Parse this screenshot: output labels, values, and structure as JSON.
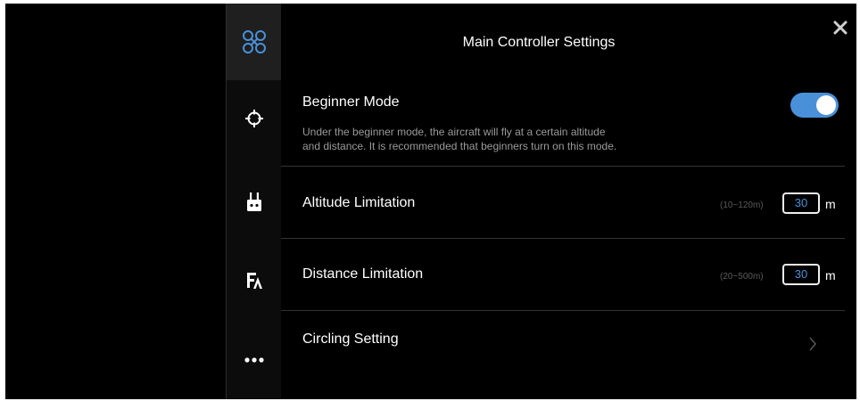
{
  "header": {
    "title": "Main Controller Settings"
  },
  "sidebar": {
    "items": [
      {
        "icon": "drone-icon",
        "active": true
      },
      {
        "icon": "crosshair-icon",
        "active": false
      },
      {
        "icon": "remote-controller-icon",
        "active": false
      },
      {
        "icon": "display-settings-icon",
        "active": false
      },
      {
        "icon": "more-icon",
        "active": false
      }
    ]
  },
  "settings": {
    "beginner_mode": {
      "label": "Beginner Mode",
      "enabled": true,
      "description_line1": "Under the beginner mode, the aircraft will fly at a certain altitude",
      "description_line2": "and distance. It is recommended that beginners turn on this mode."
    },
    "altitude_limitation": {
      "label": "Altitude Limitation",
      "range": "(10~120m)",
      "value": "30",
      "unit": "m"
    },
    "distance_limitation": {
      "label": "Distance Limitation",
      "range": "(20~500m)",
      "value": "30",
      "unit": "m"
    },
    "circling_setting": {
      "label": "Circling Setting"
    }
  },
  "colors": {
    "accent": "#4a90d9",
    "background": "#000000",
    "sidebar": "#0c0c0c",
    "sidebar_active": "#1f1f1f",
    "divider": "#333333"
  }
}
